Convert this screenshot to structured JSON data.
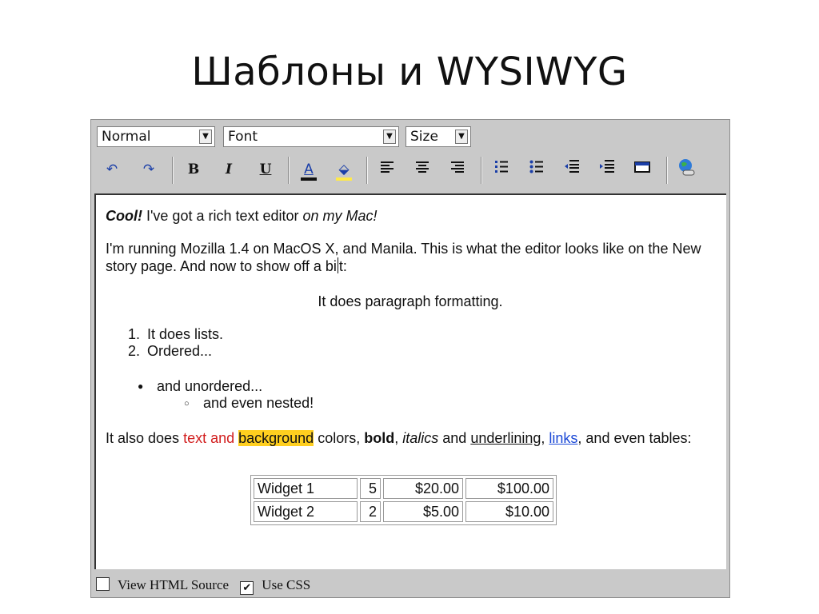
{
  "slide": {
    "title": "Шаблоны и WYSIWYG"
  },
  "toolbar": {
    "paragraph_select": "Normal",
    "font_select": "Font",
    "size_select": "Size",
    "buttons": {
      "undo": "↶",
      "redo": "↷",
      "bold": "B",
      "italic": "I",
      "underline": "U",
      "text_color": "A",
      "bg_color": "⬙"
    }
  },
  "content": {
    "p1": {
      "cool": "Cool!",
      "text": " I've got a rich text editor ",
      "italic": "on my Mac!"
    },
    "p2": {
      "before_caret": "I'm running Mozilla 1.4 on MacOS X, and Manila. This is what the editor looks like on the New story page. And now to show off a bi",
      "after_caret": "t:"
    },
    "center_paragraph": "It does paragraph formatting.",
    "ordered_list": [
      "It does lists.",
      "Ordered..."
    ],
    "unordered_list": [
      "and unordered..."
    ],
    "nested_list": [
      "and even nested!"
    ],
    "p3": {
      "t1": "It also does ",
      "red": "text and",
      "t2": " ",
      "highlight": "background",
      "t3": " colors, ",
      "bold": "bold",
      "t4": ", ",
      "italic": "italics",
      "t5": " and ",
      "underline": "underlining",
      "t6": ", ",
      "link": "links",
      "t7": ", and even tables:"
    },
    "table": [
      [
        "Widget 1",
        "5",
        "$20.00",
        "$100.00"
      ],
      [
        "Widget 2",
        "2",
        "$5.00",
        "$10.00"
      ]
    ]
  },
  "bottombar": {
    "view_html_source": "View HTML Source",
    "view_html_checked": false,
    "use_css": "Use CSS",
    "use_css_checked": true
  },
  "colors": {
    "text_red": "#d21e1e",
    "highlight": "#ffcf1f",
    "link": "#1a48d6",
    "text_color_bar": "#111111",
    "bg_color_bar": "#ffe94a"
  }
}
